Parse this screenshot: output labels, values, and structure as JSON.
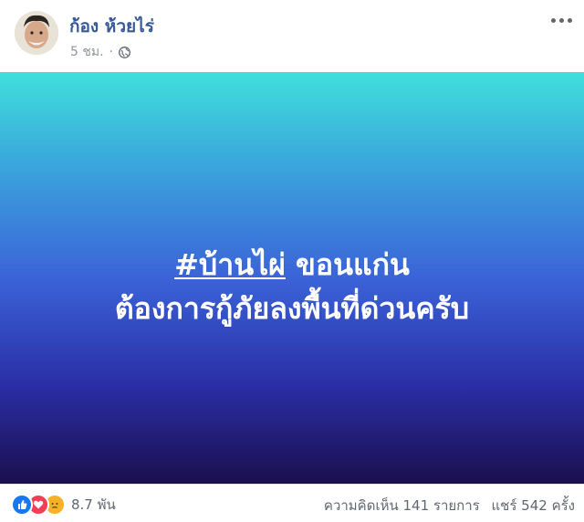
{
  "post": {
    "author_name": "ก้อง ห้วยไร่",
    "time": "5 ชม.",
    "separator": "·",
    "privacy_icon": "globe-icon",
    "menu_icon": "more-options-icon",
    "content": {
      "hashtag": "#บ้านไผ่",
      "line1_rest": " ขอนแก่น",
      "line2": "ต้องการกู้ภัยลงพื้นที่ด่วนครับ",
      "gradient_top": "#3fe0dc",
      "gradient_bottom": "#1a0f4e"
    },
    "footer": {
      "reaction_icons": [
        "like-icon",
        "love-icon",
        "sad-icon"
      ],
      "reaction_count": "8.7 พัน",
      "comments": "ความคิดเห็น 141 รายการ",
      "shares": "แชร์ 542 ครั้ง"
    }
  }
}
